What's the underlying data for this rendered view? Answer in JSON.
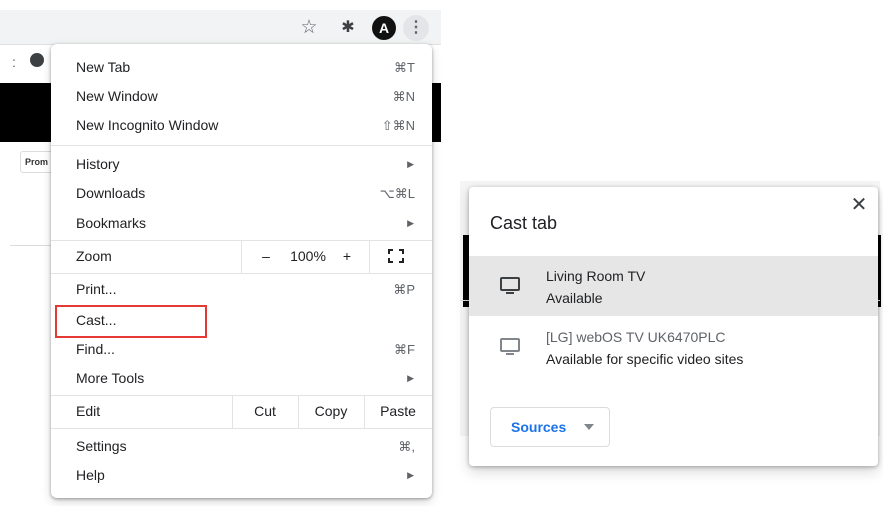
{
  "toolbar": {
    "icons": [
      "star-icon",
      "puzzle-icon",
      "profile-icon",
      "kebab-icon"
    ],
    "profile_letter": "A",
    "promo_label": "Prom"
  },
  "menu": {
    "new_tab": {
      "label": "New Tab",
      "shortcut": "⌘T"
    },
    "new_window": {
      "label": "New Window",
      "shortcut": "⌘N"
    },
    "new_incognito": {
      "label": "New Incognito Window",
      "shortcut": "⇧⌘N"
    },
    "history": {
      "label": "History"
    },
    "downloads": {
      "label": "Downloads",
      "shortcut": "⌥⌘L"
    },
    "bookmarks": {
      "label": "Bookmarks"
    },
    "zoom": {
      "label": "Zoom",
      "minus": "–",
      "value": "100%",
      "plus": "+"
    },
    "print": {
      "label": "Print...",
      "shortcut": "⌘P"
    },
    "cast": {
      "label": "Cast..."
    },
    "find": {
      "label": "Find...",
      "shortcut": "⌘F"
    },
    "more_tools": {
      "label": "More Tools"
    },
    "edit": {
      "label": "Edit",
      "cut": "Cut",
      "copy": "Copy",
      "paste": "Paste"
    },
    "settings": {
      "label": "Settings",
      "shortcut": "⌘,"
    },
    "help": {
      "label": "Help"
    },
    "submenu_arrow": "▶",
    "highlight_color": "#e53935"
  },
  "cast_dialog": {
    "title": "Cast tab",
    "close": "✕",
    "sinks": [
      {
        "name": "Living Room TV",
        "status": "Available",
        "icon": "tv-icon",
        "highlighted": true
      },
      {
        "name": "[LG] webOS TV UK6470PLC",
        "status": "Available for specific video sites",
        "icon": "tv-icon",
        "highlighted": false
      }
    ],
    "sources_label": "Sources",
    "accent": "#1a73e8"
  }
}
